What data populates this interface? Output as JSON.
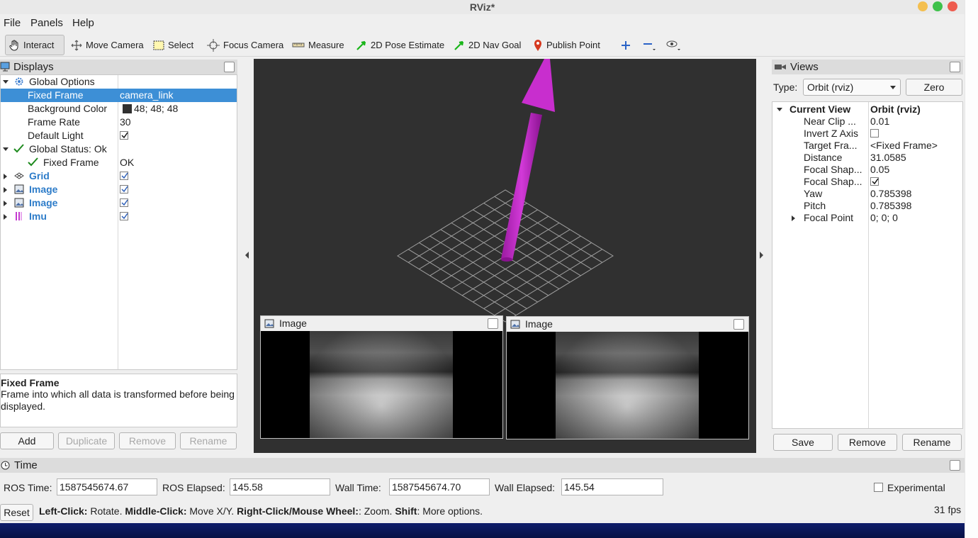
{
  "window": {
    "title": "RViz*"
  },
  "menu": [
    "File",
    "Panels",
    "Help"
  ],
  "toolbar": {
    "tools": [
      {
        "label": "Interact",
        "icon": "hand-icon"
      },
      {
        "label": "Move Camera",
        "icon": "move-camera-icon"
      },
      {
        "label": "Select",
        "icon": "select-rect-icon"
      },
      {
        "label": "Focus Camera",
        "icon": "focus-crosshair-icon"
      },
      {
        "label": "Measure",
        "icon": "ruler-icon"
      },
      {
        "label": "2D Pose Estimate",
        "icon": "green-arrow-icon"
      },
      {
        "label": "2D Nav Goal",
        "icon": "green-arrow-icon"
      },
      {
        "label": "Publish Point",
        "icon": "map-pin-icon"
      }
    ]
  },
  "displays": {
    "title": "Displays",
    "rows": [
      {
        "name": "Global Options",
        "value": ""
      },
      {
        "name": "Fixed Frame",
        "value": "camera_link"
      },
      {
        "name": "Background Color",
        "value": "48; 48; 48"
      },
      {
        "name": "Frame Rate",
        "value": "30"
      },
      {
        "name": "Default Light",
        "value": ""
      },
      {
        "name": "Global Status: Ok",
        "value": ""
      },
      {
        "name": "Fixed Frame",
        "value": "OK"
      },
      {
        "name": "Grid",
        "value": ""
      },
      {
        "name": "Image",
        "value": ""
      },
      {
        "name": "Image",
        "value": ""
      },
      {
        "name": "Imu",
        "value": ""
      }
    ],
    "desc_title": "Fixed Frame",
    "desc_text": "Frame into which all data is transformed before being displayed.",
    "buttons": [
      "Add",
      "Duplicate",
      "Remove",
      "Rename"
    ]
  },
  "viewport": {
    "image_panels": [
      "Image",
      "Image"
    ]
  },
  "views": {
    "title": "Views",
    "type_label": "Type:",
    "type_value": "Orbit (rviz)",
    "zero": "Zero",
    "current_view": "Current View",
    "current_type": "Orbit (rviz)",
    "props": [
      {
        "name": "Near Clip ...",
        "value": "0.01"
      },
      {
        "name": "Invert Z Axis",
        "value": ""
      },
      {
        "name": "Target Fra...",
        "value": "<Fixed Frame>"
      },
      {
        "name": "Distance",
        "value": "31.0585"
      },
      {
        "name": "Focal Shap...",
        "value": "0.05"
      },
      {
        "name": "Focal Shap...",
        "value": ""
      },
      {
        "name": "Yaw",
        "value": "0.785398"
      },
      {
        "name": "Pitch",
        "value": "0.785398"
      },
      {
        "name": "Focal Point",
        "value": "0; 0; 0"
      }
    ],
    "buttons": [
      "Save",
      "Remove",
      "Rename"
    ]
  },
  "time": {
    "title": "Time",
    "ros_time_label": "ROS Time:",
    "ros_time": "1587545674.67",
    "ros_elapsed_label": "ROS Elapsed:",
    "ros_elapsed": "145.58",
    "wall_time_label": "Wall Time:",
    "wall_time": "1587545674.70",
    "wall_elapsed_label": "Wall Elapsed:",
    "wall_elapsed": "145.54",
    "experimental": "Experimental"
  },
  "status": {
    "reset": "Reset",
    "b1": "Left-Click:",
    "t1": " Rotate. ",
    "b2": "Middle-Click:",
    "t2": " Move X/Y. ",
    "b3": "Right-Click/Mouse Wheel:",
    "t3": ": Zoom. ",
    "b4": "Shift",
    "t4": ": More options.",
    "fps": "31 fps"
  },
  "colors": {
    "background": "#303030",
    "arrow": "#c020c8",
    "selection": "#3d8fd6",
    "link_blue": "#2d7cc9"
  }
}
